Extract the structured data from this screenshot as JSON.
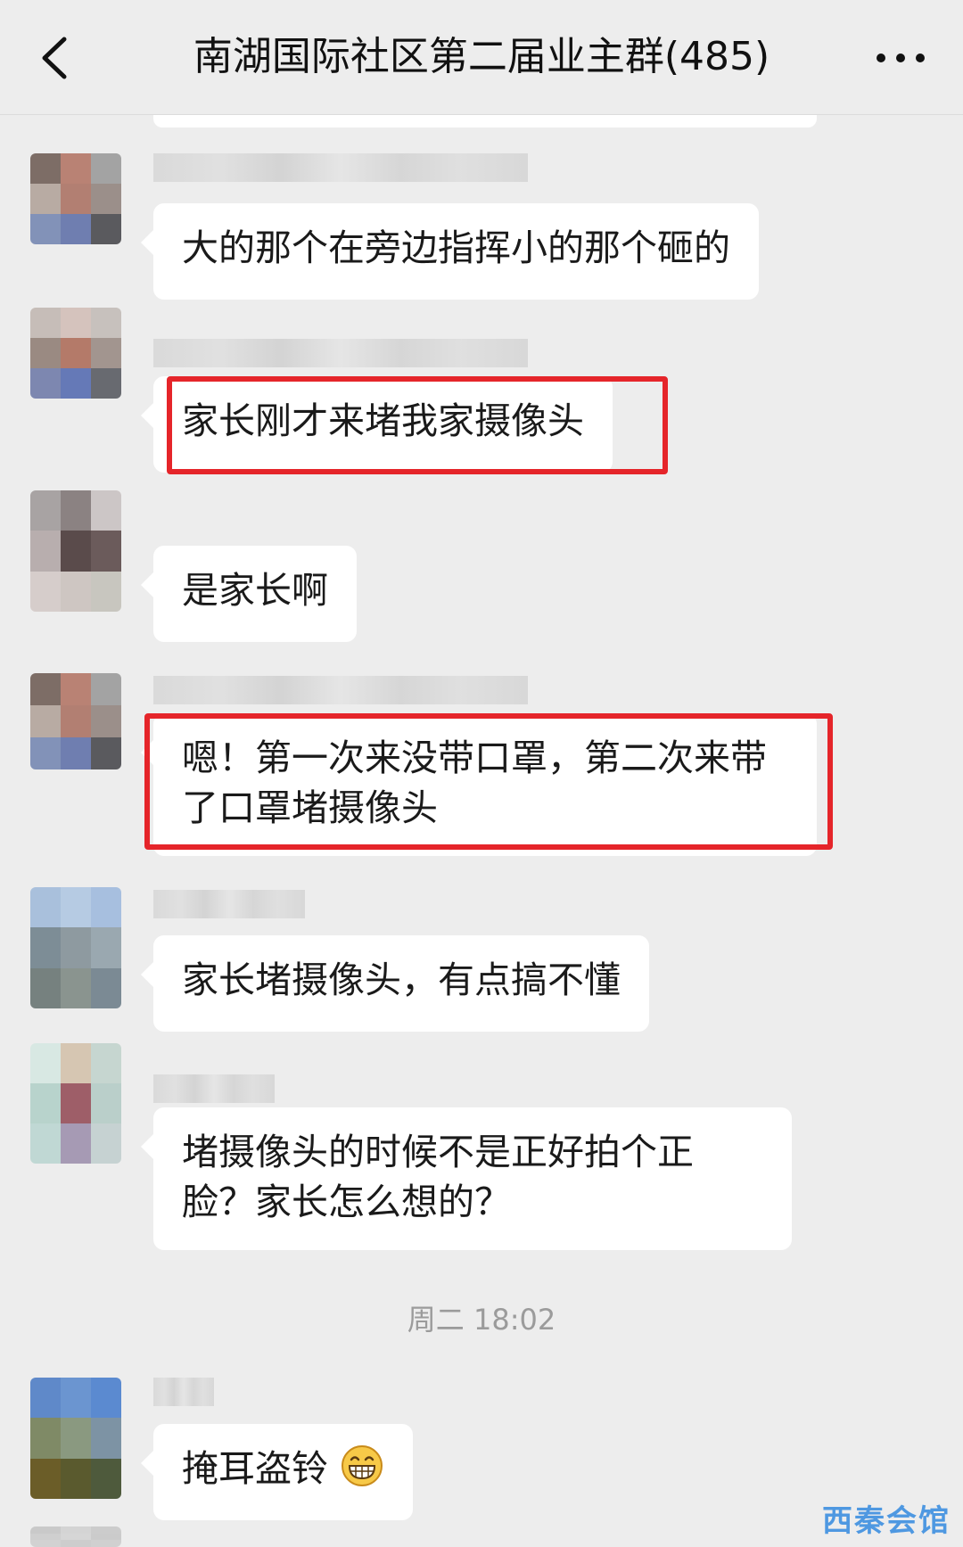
{
  "header": {
    "title": "南湖国际社区第二届业主群(485)",
    "back_icon": "chevron-left-icon",
    "more_icon": "ellipsis-icon"
  },
  "messages": [
    {
      "text": "大的那个在旁边指挥小的那个砸的",
      "highlighted": false
    },
    {
      "text": "家长刚才来堵我家摄像头",
      "highlighted": true
    },
    {
      "text": "是家长啊",
      "highlighted": false
    },
    {
      "text": "嗯！第一次来没带口罩，第二次来带了口罩堵摄像头",
      "highlighted": true
    },
    {
      "text": "家长堵摄像头，有点搞不懂",
      "highlighted": false
    },
    {
      "text": "堵摄像头的时候不是正好拍个正脸？家长怎么想的？",
      "highlighted": false
    },
    {
      "text": "掩耳盗铃",
      "highlighted": false,
      "emoji": "grinning-face-icon"
    }
  ],
  "time_divider": "周二 18:02",
  "watermark": "西秦会馆",
  "colors": {
    "background": "#ededed",
    "bubble": "#ffffff",
    "highlight": "#e5252a",
    "watermark": "#3d8fe0"
  }
}
